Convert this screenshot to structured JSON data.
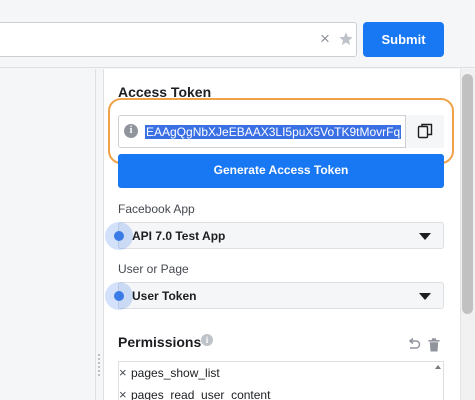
{
  "toolbar": {
    "query_value": "",
    "clear_icon": "×",
    "submit_label": "Submit"
  },
  "access_token": {
    "title": "Access Token",
    "info_icon": "i",
    "value": "EAAgQgNbXJeEBAAX3LI5puX5VoTK9tMovrFq",
    "generate_label": "Generate Access Token"
  },
  "facebook_app": {
    "label": "Facebook App",
    "selected": "API 7.0 Test App"
  },
  "user_or_page": {
    "label": "User or Page",
    "selected": "User Token"
  },
  "permissions": {
    "title": "Permissions",
    "info_icon": "i",
    "remove_icon": "×",
    "items": [
      "pages_show_list",
      "pages_read_user_content"
    ]
  },
  "colors": {
    "accent": "#1877f2",
    "highlight_outline": "#f0a24a",
    "selection": "#3b70e4",
    "click_marker": "#3a7be6"
  }
}
